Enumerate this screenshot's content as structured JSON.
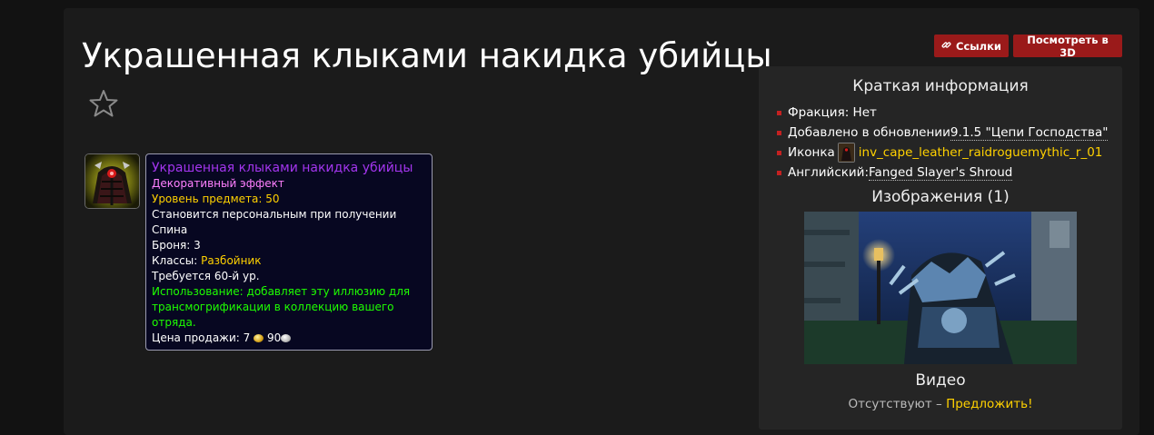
{
  "page": {
    "title": "Украшенная клыками накидка убийцы"
  },
  "toolbar": {
    "links_label": "Ссылки",
    "view3d_label": "Посмотреть в 3D"
  },
  "tooltip": {
    "name": "Украшенная клыками накидка убийцы",
    "cosmetic": "Декоративный эффект",
    "item_level": "Уровень предмета: 50",
    "binding": "Становится персональным при получении",
    "slot": "Спина",
    "armor": "Броня: 3",
    "classes_prefix": "Классы: ",
    "classes_value": "Разбойник",
    "requires": "Требуется 60-й ур.",
    "use_line1": "Использование: добавляет эту иллюзию для",
    "use_line2": "трансмогрификации в коллекцию вашего",
    "use_line3": "отряда.",
    "sell_label": "Цена продажи: ",
    "sell_gold": "7",
    "sell_silver": "90"
  },
  "sidebar": {
    "title": "Краткая информация",
    "faction": "Фракция: Нет",
    "added_prefix": "Добавлено в обновлении ",
    "added_value": "9.1.5 \"Цепи Господства\"",
    "icon_prefix": "Иконка",
    "icon_value": "inv_cape_leather_raidroguemythic_r_01",
    "english_prefix": "Английский: ",
    "english_value": "Fanged Slayer's Shroud",
    "images_title": "Изображения (1)",
    "video_title": "Видео",
    "video_none": "Отсутствуют – ",
    "video_suggest": "Предложить!"
  },
  "colors": {
    "button_red": "#9a1a1a",
    "epic_purple": "#a335ee",
    "link_yellow": "#ffd100",
    "use_green": "#1eff00",
    "bullet_red": "#c42121"
  },
  "icons": [
    "star-icon",
    "link-icon",
    "item-icon",
    "gold-coin-icon",
    "silver-coin-icon"
  ]
}
